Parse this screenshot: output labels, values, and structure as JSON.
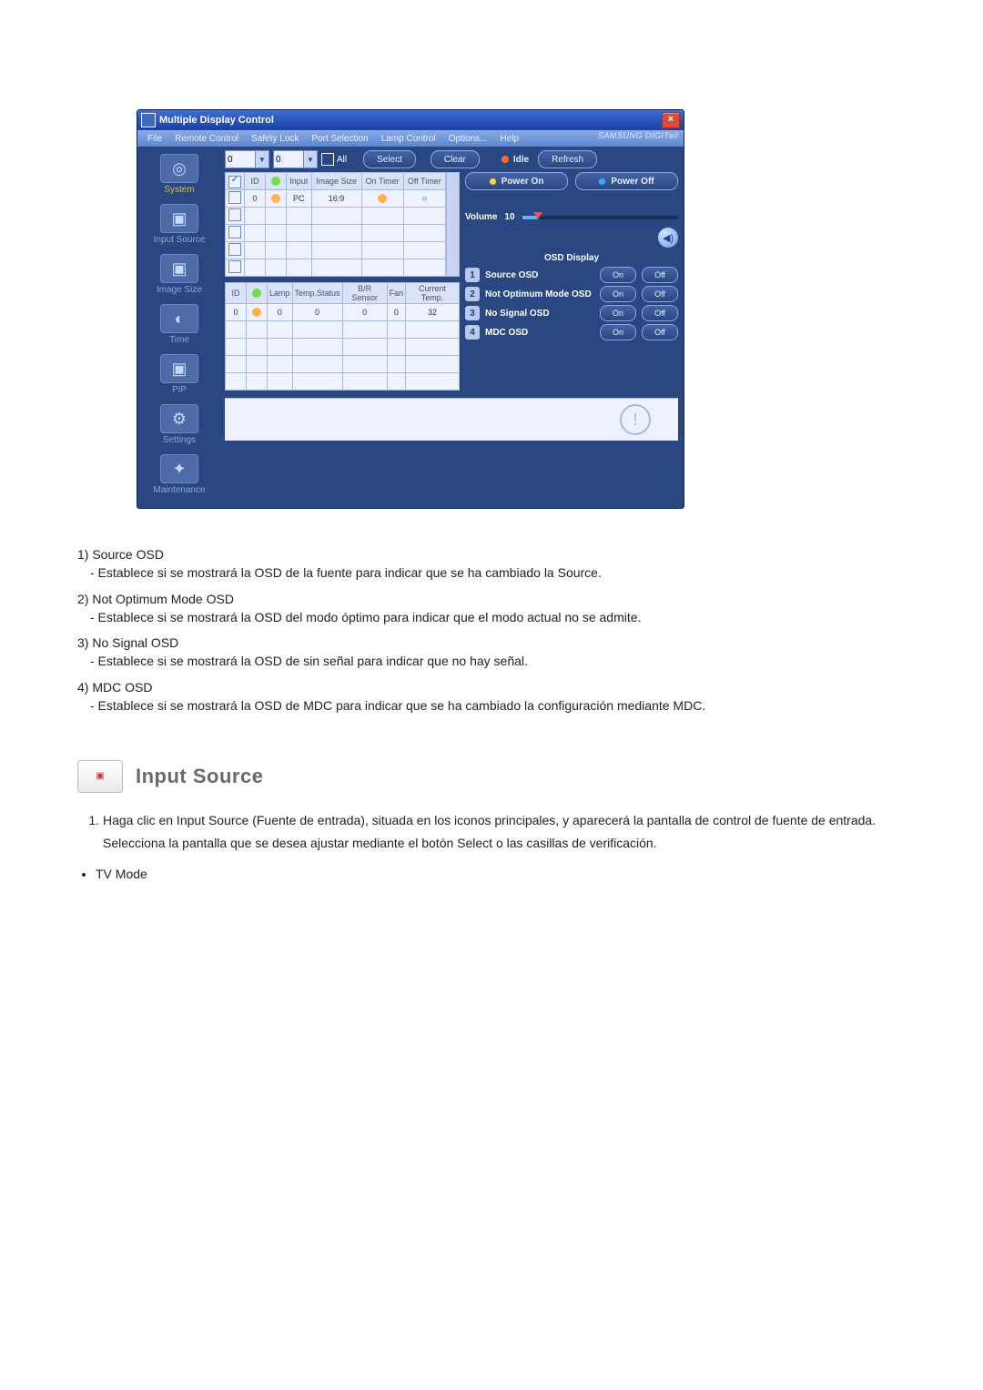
{
  "window": {
    "title": "Multiple Display Control",
    "close_label": "×",
    "brand": "SAMSUNG DIGITall"
  },
  "menubar": {
    "items": [
      "File",
      "Remote Control",
      "Safety Lock",
      "Port Selection",
      "Lamp Control",
      "Options...",
      "Help"
    ]
  },
  "sidebar": {
    "items": [
      {
        "label": "System",
        "glyph": "◎"
      },
      {
        "label": "Input Source",
        "glyph": "▣"
      },
      {
        "label": "Image Size",
        "glyph": "▣"
      },
      {
        "label": "Time",
        "glyph": "◐"
      },
      {
        "label": "PIP",
        "glyph": "▣"
      },
      {
        "label": "Settings",
        "glyph": "⚙"
      },
      {
        "label": "Maintenance",
        "glyph": "✦"
      }
    ],
    "highlight_index": 0
  },
  "toolbar": {
    "id1": "0",
    "id2": "0",
    "all_label": "All",
    "select_label": "Select",
    "clear_label": "Clear",
    "idle_label": "Idle",
    "refresh_label": "Refresh"
  },
  "table1": {
    "headers": [
      "",
      "ID",
      "",
      "Input",
      "Image Size",
      "On Timer",
      "Off Timer"
    ],
    "row": {
      "id": "0",
      "input": "PC",
      "image_size": "16:9"
    }
  },
  "table2": {
    "headers": [
      "ID",
      "",
      "Lamp",
      "Temp.Status",
      "B/R Sensor",
      "Fan",
      "Current Temp."
    ],
    "row": {
      "id": "0",
      "lamp": "0",
      "temp_status": "0",
      "br_sensor": "0",
      "fan": "0",
      "current_temp": "32"
    }
  },
  "right_panel": {
    "power_on": "Power On",
    "power_off": "Power Off",
    "volume_label": "Volume",
    "volume_value": "10",
    "osd_title": "OSD Display",
    "osd_items": [
      {
        "num": "1",
        "label": "Source OSD"
      },
      {
        "num": "2",
        "label": "Not Optimum Mode OSD"
      },
      {
        "num": "3",
        "label": "No Signal OSD"
      },
      {
        "num": "4",
        "label": "MDC OSD"
      }
    ],
    "on_label": "On",
    "off_label": "Off"
  },
  "doc": {
    "items": [
      {
        "title": "1)  Source OSD",
        "desc": "- Establece si se mostrará la OSD de la fuente para indicar que se ha cambiado la Source."
      },
      {
        "title": "2)  Not Optimum Mode OSD",
        "desc": "- Establece si se mostrará la OSD del modo óptimo para indicar que el modo actual no se admite."
      },
      {
        "title": "3)  No Signal OSD",
        "desc": "- Establece si se mostrará la OSD de sin señal para indicar que no hay señal."
      },
      {
        "title": "4)  MDC OSD",
        "desc": "- Establece si se mostrará la OSD de MDC para indicar que se ha cambiado la configuración mediante MDC."
      }
    ],
    "section_title": "Input Source",
    "step1_a": "Haga clic en Input Source (Fuente de entrada), situada en los iconos principales, y aparecerá la pantalla de control de fuente de entrada.",
    "step1_b": "Selecciona la pantalla que se desea ajustar mediante el botón Select o las casillas de verificación.",
    "bullet1": "TV Mode"
  }
}
